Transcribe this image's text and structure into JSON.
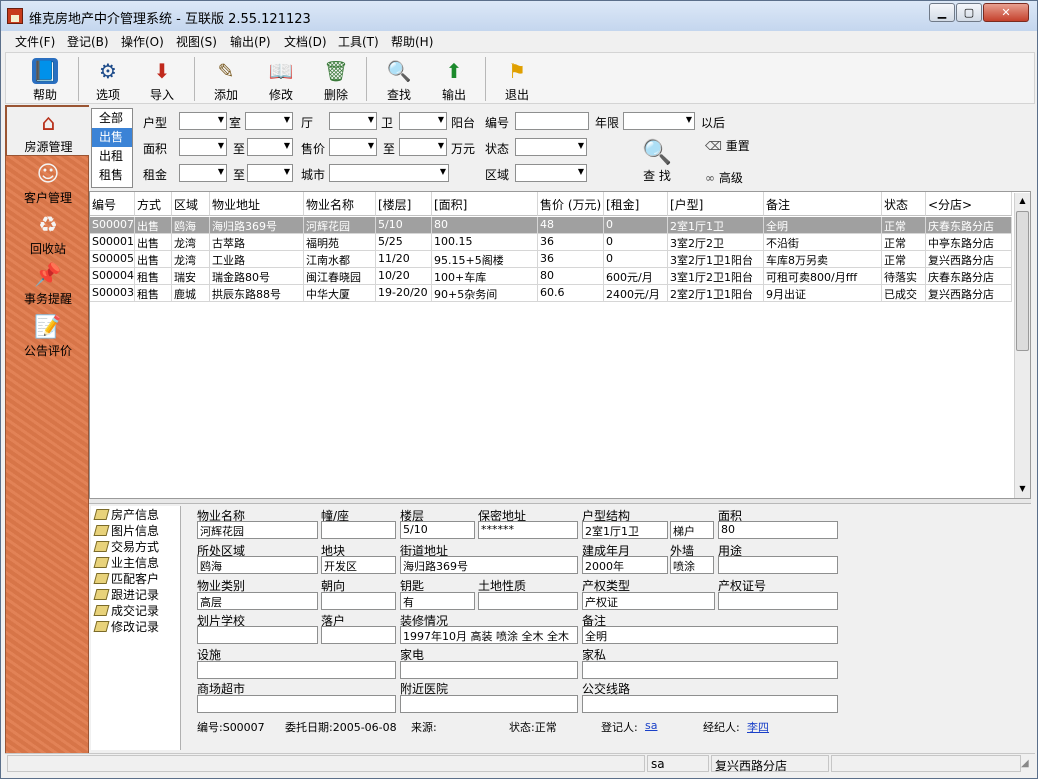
{
  "window": {
    "title": "维克房地产中介管理系统 - 互联版 2.55.121123"
  },
  "menu": [
    "文件(F)",
    "登记(B)",
    "操作(O)",
    "视图(S)",
    "输出(P)",
    "文档(D)",
    "工具(T)",
    "帮助(H)"
  ],
  "toolbar": {
    "help": "帮助",
    "options": "选项",
    "import": "导入",
    "add": "添加",
    "edit": "修改",
    "delete": "删除",
    "find": "查找",
    "export": "输出",
    "exit": "退出"
  },
  "sidebar": {
    "property": "房源管理",
    "customer": "客户管理",
    "recycle": "回收站",
    "reminder": "事务提醒",
    "notice": "公告评价"
  },
  "filter": {
    "modes": [
      "全部",
      "出售",
      "出租",
      "租售"
    ],
    "layout": "户型",
    "room": "室",
    "hall": "厅",
    "bath": "卫",
    "balcony": "阳台",
    "code": "编号",
    "years": "年限",
    "after": "以后",
    "area": "面积",
    "to1": "至",
    "price": "售价",
    "to2": "至",
    "wan": "万元",
    "status": "状态",
    "rent": "租金",
    "to3": "至",
    "city": "城市",
    "district": "区域",
    "reset": "重置",
    "search": "查 找",
    "advanced": "高级"
  },
  "grid": {
    "columns": [
      "编号",
      "方式",
      "区域",
      "物业地址",
      "物业名称",
      "[楼层]",
      "[面积]",
      "售价 (万元)",
      "[租金]",
      "[户型]",
      "备注",
      "状态",
      "<分店>"
    ],
    "rows": [
      [
        "S00007",
        "出售",
        "鸥海",
        "海归路369号",
        "河辉花园",
        "5/10",
        "80",
        "48",
        "0",
        "2室1厅1卫",
        "全明",
        "正常",
        "庆春东路分店"
      ],
      [
        "S00001",
        "出售",
        "龙湾",
        "古萃路",
        "福明苑",
        "5/25",
        "100.15",
        "36",
        "0",
        "3室2厅2卫",
        "不沿街",
        "正常",
        "中亭东路分店"
      ],
      [
        "S00005",
        "出售",
        "龙湾",
        "工业路",
        "江南水都",
        "11/20",
        "95.15+5阁楼",
        "36",
        "0",
        "3室2厅1卫1阳台",
        "车库8万另卖",
        "正常",
        "复兴西路分店"
      ],
      [
        "S00004",
        "租售",
        "瑞安",
        "瑞金路80号",
        "闽江春晓园",
        "10/20",
        "100+车库",
        "80",
        "600元/月",
        "3室1厅2卫1阳台",
        "可租可卖800/月fff",
        "待落实",
        "庆春东路分店"
      ],
      [
        "S00003",
        "租售",
        "鹿城",
        "拱辰东路88号",
        "中华大厦",
        "19-20/20",
        "90+5杂务间",
        "60.6",
        "2400元/月",
        "2室2厅1卫1阳台",
        "9月出证",
        "已成交",
        "复兴西路分店"
      ]
    ]
  },
  "tree": [
    "房产信息",
    "图片信息",
    "交易方式",
    "业主信息",
    "匹配客户",
    "跟进记录",
    "成交记录",
    "修改记录"
  ],
  "detail": {
    "labels": {
      "name": "物业名称",
      "building": "幢/座",
      "floor": "楼层",
      "secret_addr": "保密地址",
      "structure": "户型结构",
      "area": "面积",
      "district": "所处区域",
      "block": "地块",
      "street": "街道地址",
      "built": "建成年月",
      "facade": "外墙",
      "usage": "用途",
      "category": "物业类别",
      "orientation": "朝向",
      "key": "钥匙",
      "land": "土地性质",
      "title_type": "产权类型",
      "title_no": "产权证号",
      "school": "划片学校",
      "hukou": "落户",
      "decoration": "装修情况",
      "remark": "备注",
      "facilities": "设施",
      "appliances": "家电",
      "furniture": "家私",
      "market": "商场超市",
      "hospital": "附近医院",
      "bus": "公交线路"
    },
    "values": {
      "name": "河辉花园",
      "building": "",
      "floor": "5/10",
      "secret_addr": "******",
      "structure": "2室1厅1卫",
      "ladder": "梯户",
      "area": "80",
      "district": "鸥海",
      "block": "开发区",
      "street": "海归路369号",
      "built": "2000年",
      "facade": "喷涂",
      "usage": "",
      "category": "高层",
      "orientation": "",
      "key": "有",
      "land": "",
      "title_type": "产权证",
      "title_no": "",
      "school": "",
      "hukou": "",
      "decoration": "1997年10月 高装 喷涂 全木 全木",
      "remark": "全明",
      "facilities": "",
      "appliances": "",
      "furniture": "",
      "market": "",
      "hospital": "",
      "bus": ""
    },
    "footer": {
      "code": "编号:S00007",
      "date": "委托日期:2005-06-08",
      "source": "来源:",
      "status": "状态:正常",
      "registrar_label": "登记人:",
      "registrar": "sa",
      "agent_label": "经纪人:",
      "agent": "李四"
    }
  },
  "status": {
    "user": "sa",
    "branch": "复兴西路分店"
  }
}
